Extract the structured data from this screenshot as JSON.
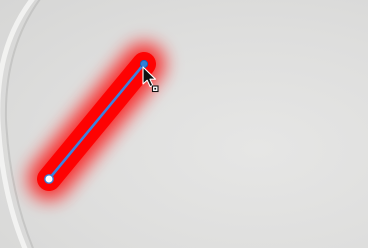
{
  "tool": {
    "name": "line-selection",
    "glow_color": "#ff0000",
    "line_color": "#3b82e0",
    "handle_start_color": "#ffffff",
    "handle_end_color": "#2f7fd9",
    "cursor_icon": "move-arrow-cursor-icon"
  }
}
